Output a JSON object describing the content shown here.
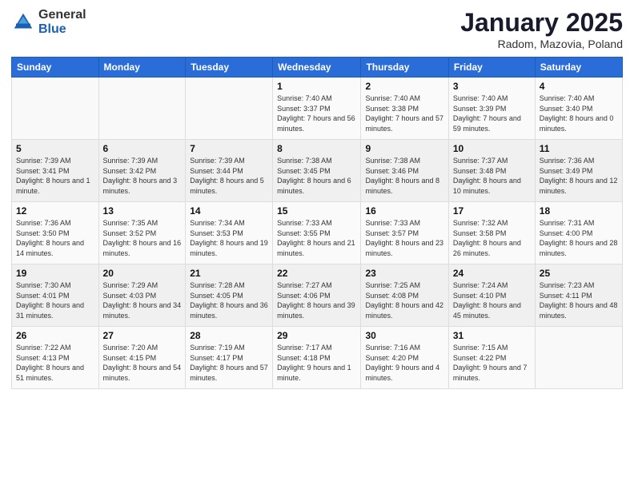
{
  "logo": {
    "general": "General",
    "blue": "Blue"
  },
  "header": {
    "title": "January 2025",
    "subtitle": "Radom, Mazovia, Poland"
  },
  "weekdays": [
    "Sunday",
    "Monday",
    "Tuesday",
    "Wednesday",
    "Thursday",
    "Friday",
    "Saturday"
  ],
  "weeks": [
    [
      {
        "day": "",
        "sunrise": "",
        "sunset": "",
        "daylight": ""
      },
      {
        "day": "",
        "sunrise": "",
        "sunset": "",
        "daylight": ""
      },
      {
        "day": "",
        "sunrise": "",
        "sunset": "",
        "daylight": ""
      },
      {
        "day": "1",
        "sunrise": "Sunrise: 7:40 AM",
        "sunset": "Sunset: 3:37 PM",
        "daylight": "Daylight: 7 hours and 56 minutes."
      },
      {
        "day": "2",
        "sunrise": "Sunrise: 7:40 AM",
        "sunset": "Sunset: 3:38 PM",
        "daylight": "Daylight: 7 hours and 57 minutes."
      },
      {
        "day": "3",
        "sunrise": "Sunrise: 7:40 AM",
        "sunset": "Sunset: 3:39 PM",
        "daylight": "Daylight: 7 hours and 59 minutes."
      },
      {
        "day": "4",
        "sunrise": "Sunrise: 7:40 AM",
        "sunset": "Sunset: 3:40 PM",
        "daylight": "Daylight: 8 hours and 0 minutes."
      }
    ],
    [
      {
        "day": "5",
        "sunrise": "Sunrise: 7:39 AM",
        "sunset": "Sunset: 3:41 PM",
        "daylight": "Daylight: 8 hours and 1 minute."
      },
      {
        "day": "6",
        "sunrise": "Sunrise: 7:39 AM",
        "sunset": "Sunset: 3:42 PM",
        "daylight": "Daylight: 8 hours and 3 minutes."
      },
      {
        "day": "7",
        "sunrise": "Sunrise: 7:39 AM",
        "sunset": "Sunset: 3:44 PM",
        "daylight": "Daylight: 8 hours and 5 minutes."
      },
      {
        "day": "8",
        "sunrise": "Sunrise: 7:38 AM",
        "sunset": "Sunset: 3:45 PM",
        "daylight": "Daylight: 8 hours and 6 minutes."
      },
      {
        "day": "9",
        "sunrise": "Sunrise: 7:38 AM",
        "sunset": "Sunset: 3:46 PM",
        "daylight": "Daylight: 8 hours and 8 minutes."
      },
      {
        "day": "10",
        "sunrise": "Sunrise: 7:37 AM",
        "sunset": "Sunset: 3:48 PM",
        "daylight": "Daylight: 8 hours and 10 minutes."
      },
      {
        "day": "11",
        "sunrise": "Sunrise: 7:36 AM",
        "sunset": "Sunset: 3:49 PM",
        "daylight": "Daylight: 8 hours and 12 minutes."
      }
    ],
    [
      {
        "day": "12",
        "sunrise": "Sunrise: 7:36 AM",
        "sunset": "Sunset: 3:50 PM",
        "daylight": "Daylight: 8 hours and 14 minutes."
      },
      {
        "day": "13",
        "sunrise": "Sunrise: 7:35 AM",
        "sunset": "Sunset: 3:52 PM",
        "daylight": "Daylight: 8 hours and 16 minutes."
      },
      {
        "day": "14",
        "sunrise": "Sunrise: 7:34 AM",
        "sunset": "Sunset: 3:53 PM",
        "daylight": "Daylight: 8 hours and 19 minutes."
      },
      {
        "day": "15",
        "sunrise": "Sunrise: 7:33 AM",
        "sunset": "Sunset: 3:55 PM",
        "daylight": "Daylight: 8 hours and 21 minutes."
      },
      {
        "day": "16",
        "sunrise": "Sunrise: 7:33 AM",
        "sunset": "Sunset: 3:57 PM",
        "daylight": "Daylight: 8 hours and 23 minutes."
      },
      {
        "day": "17",
        "sunrise": "Sunrise: 7:32 AM",
        "sunset": "Sunset: 3:58 PM",
        "daylight": "Daylight: 8 hours and 26 minutes."
      },
      {
        "day": "18",
        "sunrise": "Sunrise: 7:31 AM",
        "sunset": "Sunset: 4:00 PM",
        "daylight": "Daylight: 8 hours and 28 minutes."
      }
    ],
    [
      {
        "day": "19",
        "sunrise": "Sunrise: 7:30 AM",
        "sunset": "Sunset: 4:01 PM",
        "daylight": "Daylight: 8 hours and 31 minutes."
      },
      {
        "day": "20",
        "sunrise": "Sunrise: 7:29 AM",
        "sunset": "Sunset: 4:03 PM",
        "daylight": "Daylight: 8 hours and 34 minutes."
      },
      {
        "day": "21",
        "sunrise": "Sunrise: 7:28 AM",
        "sunset": "Sunset: 4:05 PM",
        "daylight": "Daylight: 8 hours and 36 minutes."
      },
      {
        "day": "22",
        "sunrise": "Sunrise: 7:27 AM",
        "sunset": "Sunset: 4:06 PM",
        "daylight": "Daylight: 8 hours and 39 minutes."
      },
      {
        "day": "23",
        "sunrise": "Sunrise: 7:25 AM",
        "sunset": "Sunset: 4:08 PM",
        "daylight": "Daylight: 8 hours and 42 minutes."
      },
      {
        "day": "24",
        "sunrise": "Sunrise: 7:24 AM",
        "sunset": "Sunset: 4:10 PM",
        "daylight": "Daylight: 8 hours and 45 minutes."
      },
      {
        "day": "25",
        "sunrise": "Sunrise: 7:23 AM",
        "sunset": "Sunset: 4:11 PM",
        "daylight": "Daylight: 8 hours and 48 minutes."
      }
    ],
    [
      {
        "day": "26",
        "sunrise": "Sunrise: 7:22 AM",
        "sunset": "Sunset: 4:13 PM",
        "daylight": "Daylight: 8 hours and 51 minutes."
      },
      {
        "day": "27",
        "sunrise": "Sunrise: 7:20 AM",
        "sunset": "Sunset: 4:15 PM",
        "daylight": "Daylight: 8 hours and 54 minutes."
      },
      {
        "day": "28",
        "sunrise": "Sunrise: 7:19 AM",
        "sunset": "Sunset: 4:17 PM",
        "daylight": "Daylight: 8 hours and 57 minutes."
      },
      {
        "day": "29",
        "sunrise": "Sunrise: 7:17 AM",
        "sunset": "Sunset: 4:18 PM",
        "daylight": "Daylight: 9 hours and 1 minute."
      },
      {
        "day": "30",
        "sunrise": "Sunrise: 7:16 AM",
        "sunset": "Sunset: 4:20 PM",
        "daylight": "Daylight: 9 hours and 4 minutes."
      },
      {
        "day": "31",
        "sunrise": "Sunrise: 7:15 AM",
        "sunset": "Sunset: 4:22 PM",
        "daylight": "Daylight: 9 hours and 7 minutes."
      },
      {
        "day": "",
        "sunrise": "",
        "sunset": "",
        "daylight": ""
      }
    ]
  ]
}
